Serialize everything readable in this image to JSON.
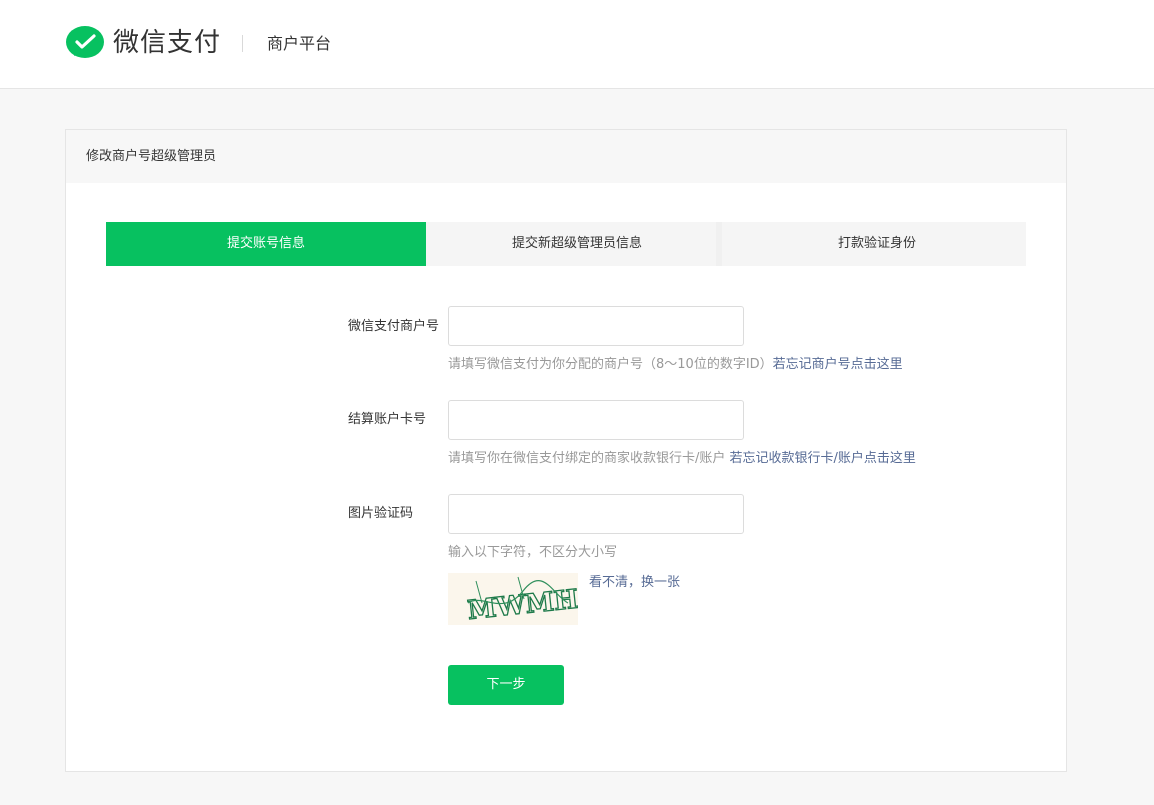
{
  "header": {
    "logo_icon": "wechat-pay-check-icon",
    "logo_text": "微信支付",
    "platform": "商户平台"
  },
  "panel": {
    "title": "修改商户号超级管理员"
  },
  "steps": [
    {
      "label": "提交账号信息",
      "active": true
    },
    {
      "label": "提交新超级管理员信息",
      "active": false
    },
    {
      "label": "打款验证身份",
      "active": false
    }
  ],
  "form": {
    "merchant_id": {
      "label": "微信支付商户号",
      "value": "",
      "placeholder": "",
      "hint": "请填写微信支付为你分配的商户号（8～10位的数字ID）",
      "link": "若忘记商户号点击这里"
    },
    "settlement_card": {
      "label": "结算账户卡号",
      "value": "",
      "placeholder": "",
      "hint": "请填写你在微信支付绑定的商家收款银行卡/账户",
      "link": "若忘记收款银行卡/账户点击这里"
    },
    "captcha": {
      "label": "图片验证码",
      "value": "",
      "placeholder": "",
      "hint": "输入以下字符，不区分大小写",
      "image_text": "MWMH",
      "refresh": "看不清，换一张"
    },
    "next_button": "下一步"
  },
  "colors": {
    "brand_green": "#07c160",
    "link_blue": "#576b95",
    "hint_gray": "#999999"
  }
}
